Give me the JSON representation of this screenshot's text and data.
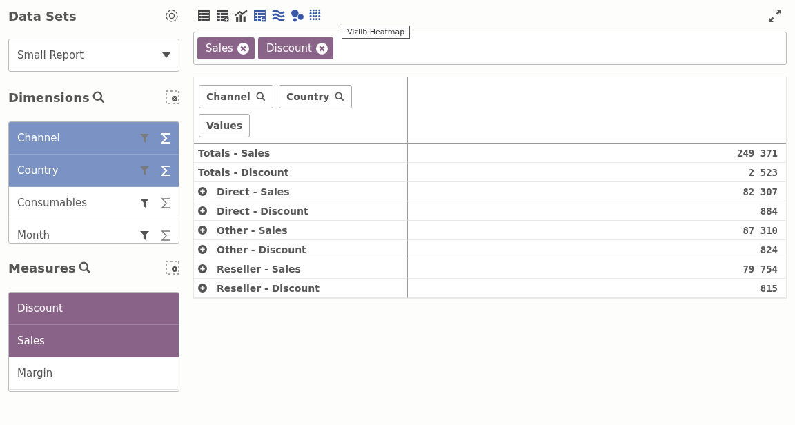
{
  "data_sets": {
    "title": "Data Sets",
    "dropdown": {
      "value": "Small Report"
    }
  },
  "dimensions": {
    "title": "Dimensions",
    "items": [
      {
        "label": "Channel",
        "selected": true
      },
      {
        "label": "Country",
        "selected": true
      },
      {
        "label": "Consumables",
        "selected": false
      },
      {
        "label": "Month",
        "selected": false
      }
    ]
  },
  "measures": {
    "title": "Measures",
    "items": [
      {
        "label": "Discount",
        "selected": true
      },
      {
        "label": "Sales",
        "selected": true
      },
      {
        "label": "Margin",
        "selected": false
      }
    ]
  },
  "tooltip": "Vizlib Heatmap",
  "measure_chips": [
    "Sales",
    "Discount"
  ],
  "pivot": {
    "header_chips": [
      {
        "label": "Channel",
        "kind": "search"
      },
      {
        "label": "Country",
        "kind": "search"
      },
      {
        "label": "Values",
        "kind": "plain"
      }
    ],
    "rows": [
      {
        "label": "Totals - Sales",
        "value": "249 371",
        "kind": "total"
      },
      {
        "label": "Totals - Discount",
        "value": "2 523",
        "kind": "total"
      },
      {
        "label": "Direct - Sales",
        "value": "82 307",
        "kind": "group"
      },
      {
        "label": "Direct - Discount",
        "value": "884",
        "kind": "group"
      },
      {
        "label": "Other - Sales",
        "value": "87 310",
        "kind": "group"
      },
      {
        "label": "Other - Discount",
        "value": "824",
        "kind": "group"
      },
      {
        "label": "Reseller - Sales",
        "value": "79 754",
        "kind": "group"
      },
      {
        "label": "Reseller - Discount",
        "value": "815",
        "kind": "group"
      }
    ]
  }
}
